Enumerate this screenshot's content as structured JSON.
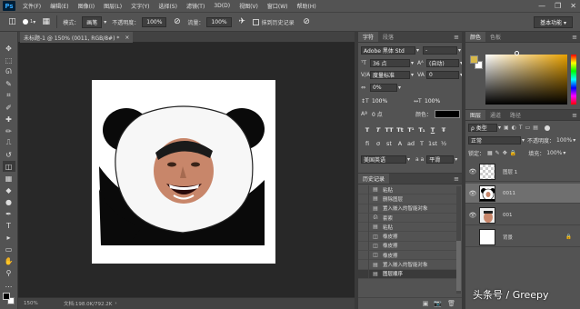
{
  "app": {
    "logo": "Ps"
  },
  "menu": [
    "文件(F)",
    "编辑(E)",
    "图像(I)",
    "图层(L)",
    "文字(Y)",
    "选择(S)",
    "滤镜(T)",
    "3D(D)",
    "视图(V)",
    "窗口(W)",
    "帮助(H)"
  ],
  "window_controls": {
    "minimize": "—",
    "restore": "❐",
    "close": "✕"
  },
  "options": {
    "brush_size": "1",
    "mode_label": "模式：",
    "mode_value": "画笔",
    "opacity_label": "不透明度：",
    "opacity_value": "100%",
    "flow_label": "流量：",
    "flow_value": "100%",
    "history_label": "抹到历史记录",
    "workspace": "基本功能"
  },
  "document": {
    "tab_title": "未标题-1 @ 150% (0011, RGB/8#) *",
    "close": "×",
    "zoom": "150%",
    "doc_info": "文档:198.0K/792.2K"
  },
  "tools": [
    "move",
    "marquee",
    "lasso",
    "quick-select",
    "crop",
    "eyedropper",
    "healing",
    "brush",
    "stamp",
    "history-brush",
    "eraser",
    "gradient",
    "blur",
    "dodge",
    "pen",
    "type",
    "path-select",
    "shape",
    "hand",
    "zoom",
    "more"
  ],
  "tool_glyphs": [
    "✥",
    "⬚",
    "ᘏ",
    "✎",
    "⌗",
    "✐",
    "✚",
    "✏",
    "⎍",
    "↺",
    "◫",
    "▦",
    "◆",
    "●",
    "✒",
    "T",
    "▸",
    "▭",
    "✋",
    "⚲",
    "…"
  ],
  "char_panel": {
    "tabs": [
      "字符",
      "段落"
    ],
    "font_family": "Adobe 黑体 Std",
    "font_style": "-",
    "size": "36 点",
    "leading": "(自动)",
    "kerning": "度量标准",
    "tracking": "0",
    "scale_pct": "0%",
    "vscale": "100%",
    "hscale": "100%",
    "baseline": "0 点",
    "color_label": "颜色：",
    "text_buttons": [
      "T",
      "T",
      "TT",
      "Tt",
      "T¹",
      "T₁",
      "T",
      "Ŧ"
    ],
    "extra_buttons": [
      "fi",
      "σ",
      "st",
      "A",
      "ad",
      "T",
      "1st",
      "½"
    ],
    "language": "美国英语",
    "antialias": "平滑",
    "aa_prefix": "a a"
  },
  "history_panel": {
    "tabs": [
      "历史记录"
    ],
    "items": [
      {
        "label": "粘贴",
        "icon": "doc"
      },
      {
        "label": "删除图层",
        "icon": "doc"
      },
      {
        "label": "置入嵌入的智能对象",
        "icon": "doc"
      },
      {
        "label": "套索",
        "icon": "lasso"
      },
      {
        "label": "粘贴",
        "icon": "doc"
      },
      {
        "label": "橡皮擦",
        "icon": "eraser"
      },
      {
        "label": "橡皮擦",
        "icon": "eraser"
      },
      {
        "label": "橡皮擦",
        "icon": "eraser"
      },
      {
        "label": "置入嵌入的智能对象",
        "icon": "doc"
      },
      {
        "label": "图层顺序",
        "icon": "doc"
      }
    ],
    "active_index": 9,
    "footer_icons": [
      "▣",
      "📷",
      "🗑"
    ]
  },
  "color_panel": {
    "tabs": [
      "颜色",
      "色板"
    ],
    "fg": "#d7b84a",
    "bg": "#ffffff"
  },
  "layers_panel": {
    "tabs": [
      "图层",
      "通道",
      "路径"
    ],
    "filter": "ρ 类型",
    "blend": "正常",
    "opacity_label": "不透明度：",
    "opacity": "100%",
    "lock_label": "锁定：",
    "fill_label": "填充：",
    "fill": "100%",
    "layers": [
      {
        "name": "图层 1",
        "visible": true,
        "thumb": "check"
      },
      {
        "name": "0011",
        "visible": true,
        "thumb": "panda",
        "selected": true
      },
      {
        "name": "001",
        "visible": true,
        "thumb": "face"
      },
      {
        "name": "背景",
        "visible": false,
        "thumb": "white",
        "locked": true
      }
    ]
  },
  "watermark": "头条号 / Greepy"
}
